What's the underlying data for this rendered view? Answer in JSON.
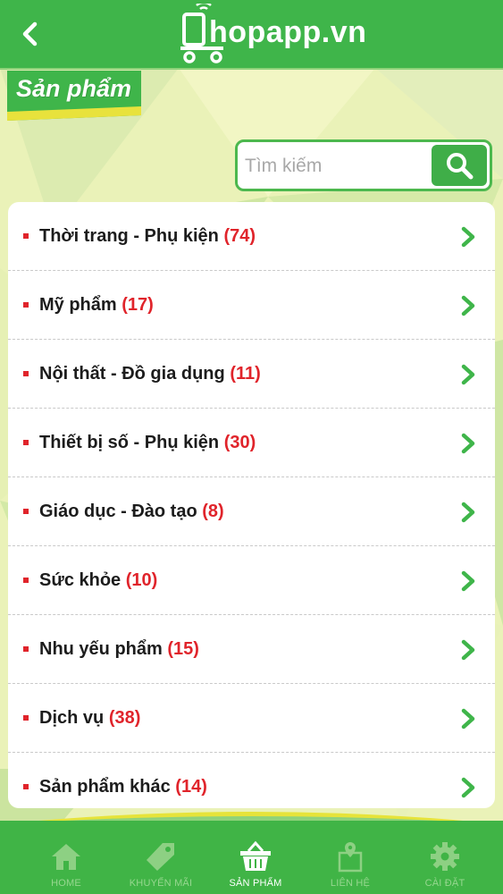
{
  "header": {
    "logo_text": "hopapp.vn"
  },
  "section": {
    "title": "Sản phẩm"
  },
  "search": {
    "placeholder": "Tìm kiếm",
    "value": ""
  },
  "categories": [
    {
      "name": "Thời trang - Phụ kiện",
      "count": "(74)"
    },
    {
      "name": "Mỹ phẩm",
      "count": "(17)"
    },
    {
      "name": "Nội thất - Đồ gia dụng",
      "count": "(11)"
    },
    {
      "name": "Thiết bị số - Phụ kiện",
      "count": "(30)"
    },
    {
      "name": "Giáo dục - Đào tạo",
      "count": "(8)"
    },
    {
      "name": "Sức khỏe",
      "count": "(10)"
    },
    {
      "name": "Nhu yếu phẩm",
      "count": "(15)"
    },
    {
      "name": "Dịch vụ",
      "count": "(38)"
    },
    {
      "name": "Sản phẩm khác",
      "count": "(14)"
    }
  ],
  "tabs": [
    {
      "label": "HOME",
      "icon": "home-icon",
      "active": false
    },
    {
      "label": "KHUYẾN MÃI",
      "icon": "tag-icon",
      "active": false
    },
    {
      "label": "SẢN PHẨM",
      "icon": "basket-icon",
      "active": true
    },
    {
      "label": "LIÊN HỆ",
      "icon": "map-pin-icon",
      "active": false
    },
    {
      "label": "CÀI ĐẶT",
      "icon": "gear-icon",
      "active": false
    }
  ],
  "colors": {
    "primary_green": "#3fb54a",
    "count_red": "#e0242b",
    "background": "#e9f1b6"
  }
}
